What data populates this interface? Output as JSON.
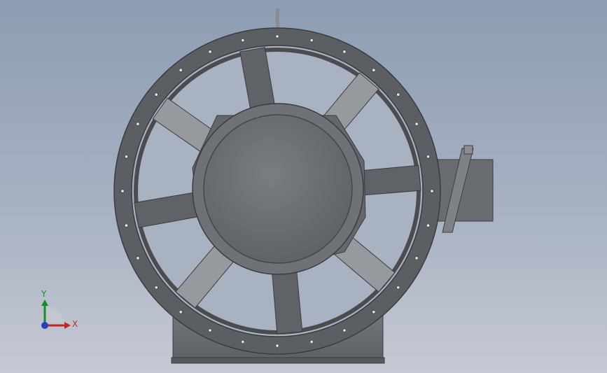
{
  "viewport": {
    "background_top": "#8d9db3",
    "background_bottom": "#c5c9d3"
  },
  "model": {
    "part": "axial-fan",
    "blade_count": 8,
    "ring_bolt_holes": 28,
    "colors": {
      "ring": "#5b5e62",
      "ring_edge": "#3a3c3f",
      "hub": "#6a6d71",
      "hub_face": "#727579",
      "blade_light": "#96999d",
      "blade_dark": "#5f6266",
      "base": "#6b6e72",
      "bolt": "#e8e8e8"
    }
  },
  "triad": {
    "y_label": "Y",
    "x_label": "X",
    "y_color": "#1d8a2b",
    "x_color": "#c0282c",
    "z_color": "#2b3fbf"
  }
}
